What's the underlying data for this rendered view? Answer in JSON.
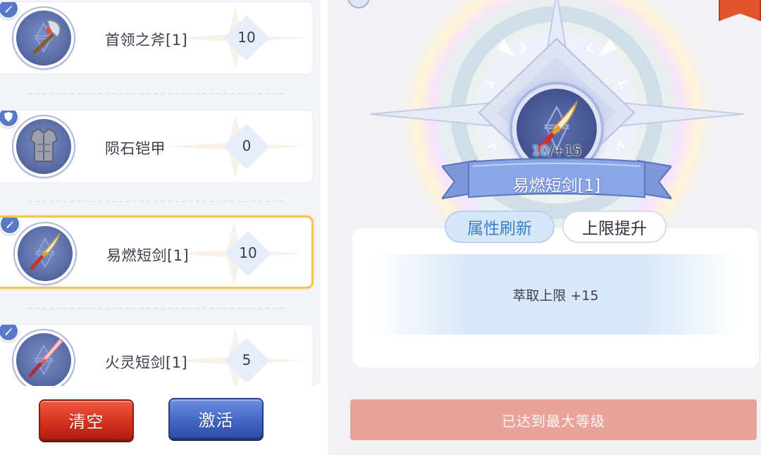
{
  "equipment_list": {
    "items": [
      {
        "name": "首领之斧[1]",
        "level": "10",
        "icon": "axe-icon",
        "badge": "sword-badge-icon"
      },
      {
        "name": "陨石铠甲",
        "level": "0",
        "icon": "armor-icon",
        "badge": "shield-badge-icon"
      },
      {
        "name": "易燃短剑[1]",
        "level": "10",
        "icon": "dagger-icon",
        "badge": "sword-badge-icon",
        "selected": true
      },
      {
        "name": "火灵短剑[1]",
        "level": "5",
        "icon": "fire-dagger-icon",
        "badge": "sword-badge-icon"
      }
    ]
  },
  "actions": {
    "clear_label": "清空",
    "activate_label": "激活"
  },
  "detail": {
    "current_level": "10",
    "max_suffix": "/+15",
    "item_name": "易燃短剑[1]",
    "tabs": {
      "refresh_label": "属性刷新",
      "upgrade_label": "上限提升"
    },
    "info_text": "萃取上限 +15",
    "max_level_label": "已达到最大等级"
  },
  "colors": {
    "selected_border": "#f3c64c",
    "clear_button": "#d6331e",
    "activate_button": "#4467c6",
    "max_button": "#e8a49b",
    "level_highlight": "#4d9be8"
  }
}
